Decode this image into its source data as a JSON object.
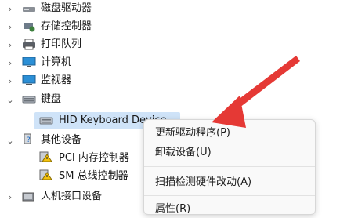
{
  "tree": {
    "items": [
      {
        "label": "磁盘驱动器",
        "expanded": false,
        "icon": "disk-drive-icon"
      },
      {
        "label": "存储控制器",
        "expanded": false,
        "icon": "storage-controller-icon"
      },
      {
        "label": "打印队列",
        "expanded": false,
        "icon": "printer-icon"
      },
      {
        "label": "计算机",
        "expanded": false,
        "icon": "computer-icon"
      },
      {
        "label": "监视器",
        "expanded": false,
        "icon": "monitor-icon"
      },
      {
        "label": "键盘",
        "expanded": true,
        "icon": "keyboard-icon"
      },
      {
        "label": "HID Keyboard Device",
        "child": true,
        "selected": true,
        "icon": "keyboard-icon"
      },
      {
        "label": "其他设备",
        "expanded": true,
        "icon": "unknown-device-icon"
      },
      {
        "label": "PCI 内存控制器",
        "child": true,
        "icon": "warning-device-icon"
      },
      {
        "label": "SM 总线控制器",
        "child": true,
        "icon": "warning-device-icon"
      },
      {
        "label": "人机接口设备",
        "expanded": false,
        "icon": "hid-icon"
      }
    ]
  },
  "context_menu": {
    "items": [
      {
        "label": "更新驱动程序(P)"
      },
      {
        "label": "卸载设备(U)"
      },
      {
        "label": "扫描检测硬件改动(A)"
      },
      {
        "label": "属性(R)"
      }
    ]
  },
  "colors": {
    "selection": "#cfe3f8",
    "arrow": "#e53935",
    "menu_bg": "#f9f9f9"
  }
}
